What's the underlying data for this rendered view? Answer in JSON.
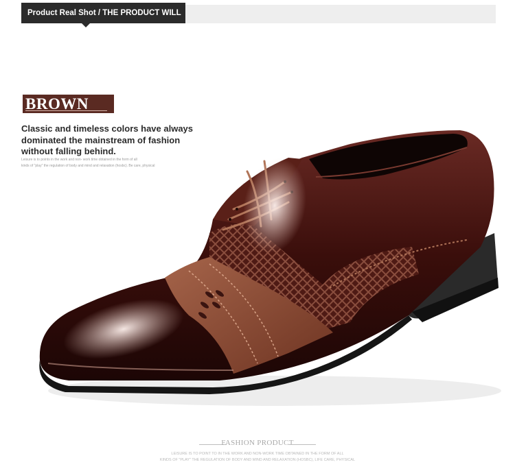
{
  "header": {
    "tab_label": "Product Real Shot / THE PRODUCT WILL"
  },
  "product": {
    "color_badge": "BROWN",
    "tagline": "Classic and timeless colors have always dominated the mainstream of fashion without falling behind.",
    "small_line_1": "Leisure is to points in the work and non- work time obtained in the form of all",
    "small_line_2": "kinds of \"play\" the regulation of body and mind and relaxation (hosbc). Be care, physical",
    "image_alt": "brown patent leather oxford dress shoe with woven mesh panel"
  },
  "footer": {
    "title": "FASHION PRODUCT",
    "small_line_1": "LEISURE IS TO POINT TO IN THE WORK AND NON-WORK TIME OBTAINED IN THE FORM OF ALL",
    "small_line_2": "KINDS OF \"PLAY\" THE REGULATION OF BODY AND MIND AND RELAXATION (HOSBC), LIFE CARE, PHYSICAL"
  },
  "colors": {
    "badge_bg": "#5a2a22",
    "header_tab_bg": "#2b2b2b",
    "header_bar_bg": "#eeeeee",
    "shoe_leather": "#4a1410",
    "shoe_tan_band": "#8a4a32"
  }
}
